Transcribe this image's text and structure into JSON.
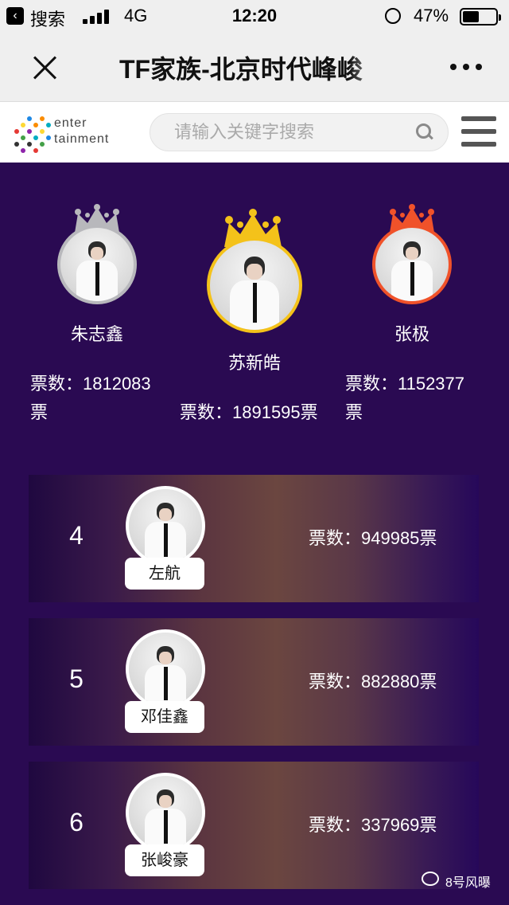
{
  "status_bar": {
    "back_label": "搜索",
    "network": "4G",
    "time": "12:20",
    "battery": "47%"
  },
  "nav": {
    "title": "TF家族-北京时代峰峻"
  },
  "site": {
    "logo_line1": "enter",
    "logo_line2": "tainment",
    "search_placeholder": "请输入关键字搜索"
  },
  "podium": {
    "first": {
      "name": "苏新皓",
      "votes_label": "票数：1891595票",
      "crown_color": "#f4c21a"
    },
    "second": {
      "name": "朱志鑫",
      "votes_line1": "票数：1812083",
      "votes_line2": "票",
      "crown_color": "#b8b8bc"
    },
    "third": {
      "name": "张极",
      "votes_line1": "票数：1152377",
      "votes_line2": "票",
      "crown_color": "#f0522a"
    }
  },
  "ranking": [
    {
      "rank": "4",
      "name": "左航",
      "votes": "票数：949985票"
    },
    {
      "rank": "5",
      "name": "邓佳鑫",
      "votes": "票数：882880票"
    },
    {
      "rank": "6",
      "name": "张峻豪",
      "votes": "票数：337969票"
    }
  ],
  "watermark": "8号风曝"
}
